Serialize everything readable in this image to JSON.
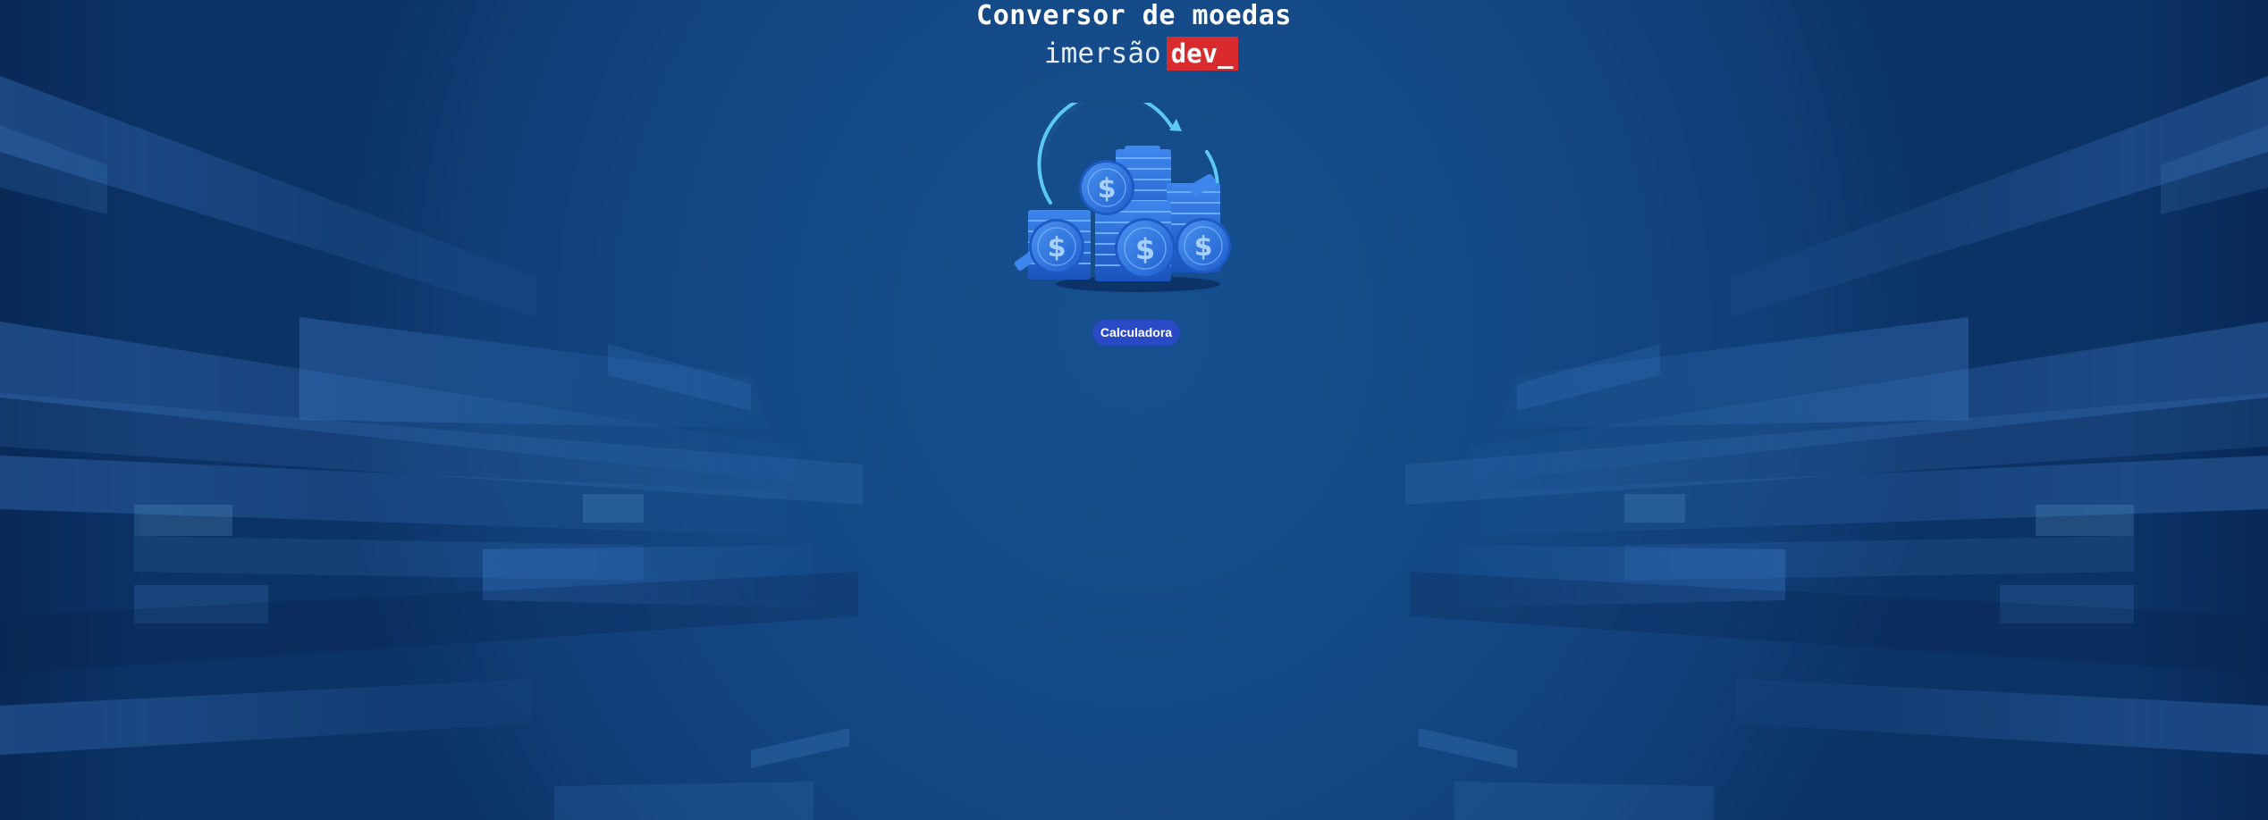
{
  "header": {
    "title": "Conversor de moedas",
    "brand_word": "imersão",
    "brand_tag": "dev_"
  },
  "illustration": {
    "icon": "coins-exchange-icon",
    "glyph": "$"
  },
  "actions": {
    "calculator_label": "Calculadora"
  },
  "colors": {
    "background": "#134582",
    "brand_tag_bg": "#d92a2e",
    "button_bg": "#2a49c4",
    "text": "#ffffff",
    "coin": "#2f7be8",
    "arrow": "#5cc8f5"
  }
}
